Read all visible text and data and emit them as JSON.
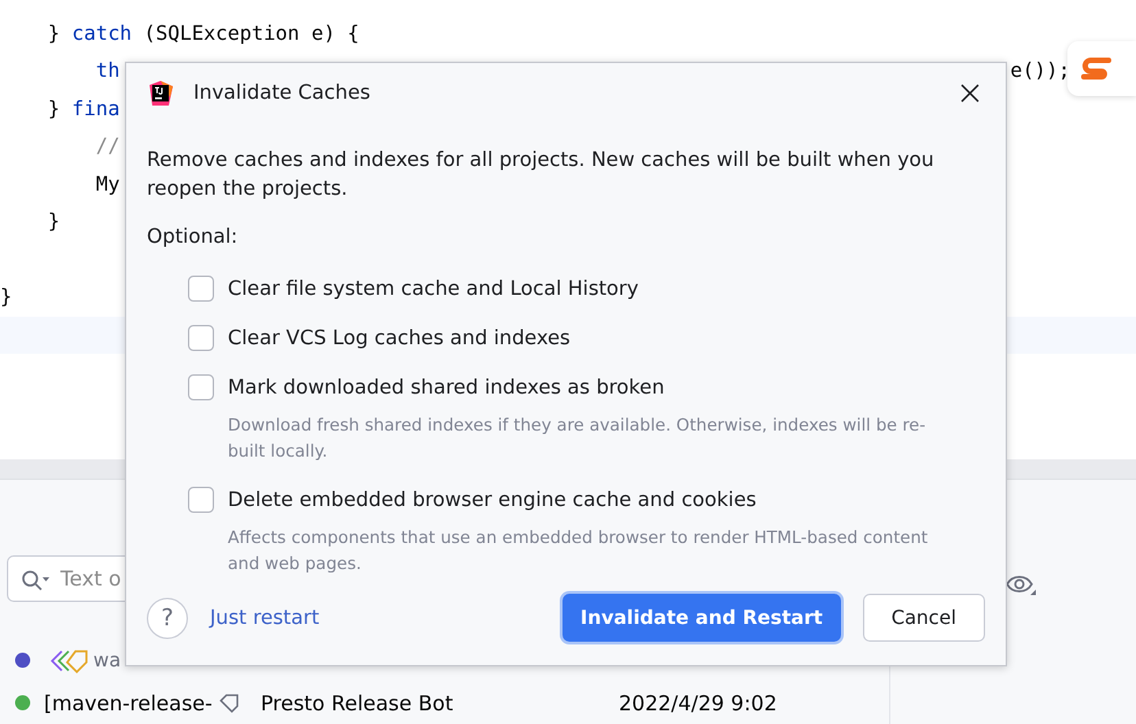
{
  "editor": {
    "blocks": [
      {
        "lines": [
          {
            "parts": [
              {
                "kind": "plain",
                "text": "    } "
              },
              {
                "kind": "keyword",
                "text": "catch"
              },
              {
                "kind": "plain",
                "text": " (SQLException e) {"
              }
            ]
          },
          {
            "parts": [
              {
                "kind": "keyword",
                "text": "        th"
              }
            ],
            "tail": "e());"
          },
          {
            "parts": [
              {
                "kind": "plain",
                "text": "    } "
              },
              {
                "kind": "keyword",
                "text": "fina"
              }
            ]
          },
          {
            "parts": [
              {
                "kind": "comment",
                "text": "        //"
              }
            ]
          },
          {
            "parts": [
              {
                "kind": "plain",
                "text": "        My"
              }
            ]
          },
          {
            "parts": [
              {
                "kind": "plain",
                "text": "    }"
              }
            ]
          }
        ]
      },
      {
        "lines": [
          {
            "parts": [
              {
                "kind": "plain",
                "text": "}"
              }
            ]
          }
        ]
      }
    ]
  },
  "log": {
    "search": {
      "placeholder": "Text o"
    },
    "commits": [
      {
        "color": "#4f4fc4",
        "kind": "tagged",
        "message": "wa"
      },
      {
        "color": "#4caf50",
        "kind": "labeled",
        "message": "[maven-release-",
        "author": "Presto Release Bot",
        "date": "2022/4/29 9:02"
      }
    ]
  },
  "dialog": {
    "title": "Invalidate Caches",
    "description": "Remove caches and indexes for all projects. New caches will be built when you reopen the projects.",
    "optional_label": "Optional:",
    "options": [
      {
        "label": "Clear file system cache and Local History",
        "checked": false
      },
      {
        "label": "Clear VCS Log caches and indexes",
        "checked": false
      },
      {
        "label": "Mark downloaded shared indexes as broken",
        "checked": false,
        "hint": "Download fresh shared indexes if they are available. Otherwise, indexes will be re-built locally."
      },
      {
        "label": "Delete embedded browser engine cache and cookies",
        "checked": false,
        "hint": "Affects components that use an embedded browser to render HTML-based content and web pages."
      }
    ],
    "help": "?",
    "link": "Just restart",
    "buttons": [
      {
        "label": "Invalidate and Restart",
        "kind": "primary"
      },
      {
        "label": "Cancel",
        "kind": "secondary"
      }
    ]
  }
}
